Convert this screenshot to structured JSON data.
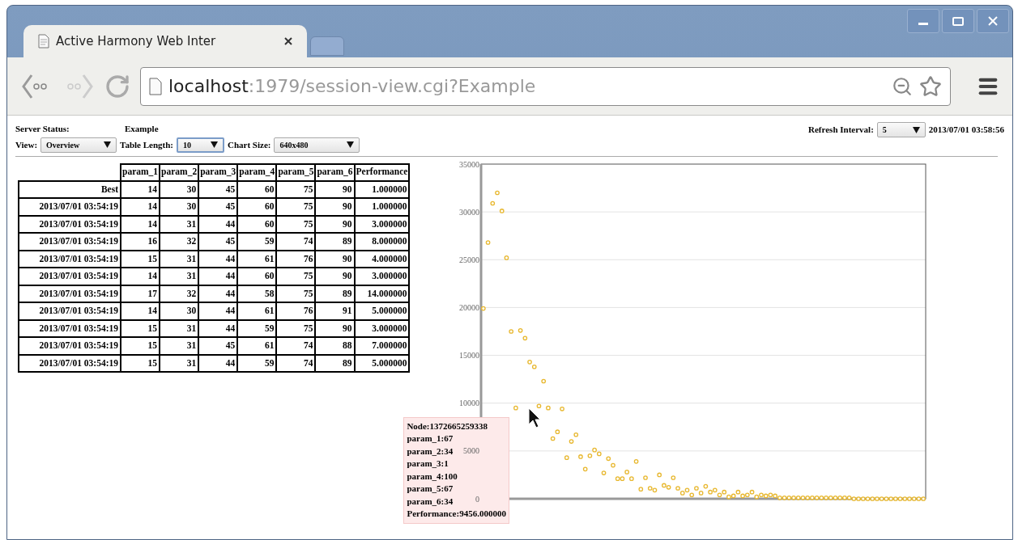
{
  "browser": {
    "tab": {
      "title": "Active Harmony Web Inter",
      "selected": true
    },
    "address": {
      "host": "localhost",
      "path": ":1979/session-view.cgi?Example"
    }
  },
  "header": {
    "server_status_label": "Server Status:",
    "server_status": "Example",
    "view": {
      "label": "View:",
      "value": "Overview"
    },
    "table_length": {
      "label": "Table Length:",
      "value": "10",
      "focused": true
    },
    "chart_size": {
      "label": "Chart Size:",
      "value": "640x480"
    },
    "refresh": {
      "label": "Refresh Interval:",
      "value": "5"
    },
    "timestamp": "2013/07/01 03:58:56"
  },
  "table": {
    "columns": [
      "param_1",
      "param_2",
      "param_3",
      "param_4",
      "param_5",
      "param_6",
      "Performance"
    ],
    "rows": [
      {
        "label": "Best",
        "cells": [
          "14",
          "30",
          "45",
          "60",
          "75",
          "90",
          "1.000000"
        ]
      },
      {
        "label": "2013/07/01 03:54:19",
        "cells": [
          "14",
          "30",
          "45",
          "60",
          "75",
          "90",
          "1.000000"
        ]
      },
      {
        "label": "2013/07/01 03:54:19",
        "cells": [
          "14",
          "31",
          "44",
          "60",
          "75",
          "90",
          "3.000000"
        ]
      },
      {
        "label": "2013/07/01 03:54:19",
        "cells": [
          "16",
          "32",
          "45",
          "59",
          "74",
          "89",
          "8.000000"
        ]
      },
      {
        "label": "2013/07/01 03:54:19",
        "cells": [
          "15",
          "31",
          "44",
          "61",
          "76",
          "90",
          "4.000000"
        ]
      },
      {
        "label": "2013/07/01 03:54:19",
        "cells": [
          "14",
          "31",
          "44",
          "60",
          "75",
          "90",
          "3.000000"
        ]
      },
      {
        "label": "2013/07/01 03:54:19",
        "cells": [
          "17",
          "32",
          "44",
          "58",
          "75",
          "89",
          "14.000000"
        ]
      },
      {
        "label": "2013/07/01 03:54:19",
        "cells": [
          "14",
          "30",
          "44",
          "61",
          "76",
          "91",
          "5.000000"
        ]
      },
      {
        "label": "2013/07/01 03:54:19",
        "cells": [
          "15",
          "31",
          "44",
          "59",
          "75",
          "90",
          "3.000000"
        ]
      },
      {
        "label": "2013/07/01 03:54:19",
        "cells": [
          "15",
          "31",
          "45",
          "61",
          "74",
          "88",
          "7.000000"
        ]
      },
      {
        "label": "2013/07/01 03:54:19",
        "cells": [
          "15",
          "31",
          "44",
          "59",
          "74",
          "89",
          "5.000000"
        ]
      }
    ]
  },
  "chart": {
    "chart_data": {
      "type": "scatter",
      "grid": true,
      "ylim": [
        0,
        35000
      ],
      "yticks": [
        0,
        5000,
        10000,
        15000,
        20000,
        25000,
        30000,
        35000
      ],
      "categories": [
        null,
        null,
        null,
        null,
        null,
        null,
        null,
        null,
        null,
        null,
        null,
        null,
        null,
        null,
        null,
        null,
        null,
        null,
        null,
        null,
        null,
        null,
        null,
        null,
        null,
        null,
        null,
        null,
        null,
        null,
        null,
        null,
        null,
        null,
        null,
        null,
        null,
        null,
        null,
        null,
        null,
        null,
        null,
        null,
        null,
        null,
        null,
        null,
        null,
        null,
        null,
        null,
        null,
        null,
        null,
        null,
        null,
        null,
        null,
        null,
        null,
        null,
        null,
        null,
        null,
        null,
        null,
        null,
        null,
        null,
        null,
        null,
        null,
        null,
        null,
        null,
        null,
        null,
        null,
        null,
        null,
        null,
        null,
        null,
        null,
        null,
        null,
        null,
        null,
        null,
        null,
        null,
        null,
        null,
        null,
        null
      ],
      "series": [
        {
          "color": "#e8b830",
          "values": [
            19900,
            26800,
            30900,
            32000,
            30100,
            25200,
            17500,
            9500,
            17600,
            16800,
            14300,
            13800,
            9700,
            12300,
            9500,
            6300,
            7000,
            9400,
            4300,
            6000,
            6700,
            4400,
            3100,
            4500,
            5100,
            4700,
            2700,
            4200,
            3500,
            2100,
            2100,
            2800,
            2100,
            3900,
            1000,
            2200,
            1100,
            900,
            2500,
            1400,
            1200,
            2200,
            1100,
            600,
            900,
            400,
            1100,
            600,
            1300,
            700,
            900,
            400,
            700,
            200,
            300,
            700,
            300,
            400,
            700,
            200,
            400,
            300,
            400,
            300,
            100,
            100,
            100,
            100,
            100,
            100,
            100,
            100,
            100,
            100,
            100,
            100,
            100,
            100,
            100,
            100,
            0,
            0,
            0,
            0,
            0,
            0,
            0,
            0,
            0,
            0,
            0,
            0,
            0,
            0,
            0,
            0
          ]
        }
      ]
    },
    "tooltip": {
      "lines": [
        "Node:1372665259338",
        "param_1:67",
        "param_2:34",
        "param_3:1",
        "param_4:100",
        "param_5:67",
        "param_6:34",
        "Performance:9456.000000"
      ]
    }
  }
}
